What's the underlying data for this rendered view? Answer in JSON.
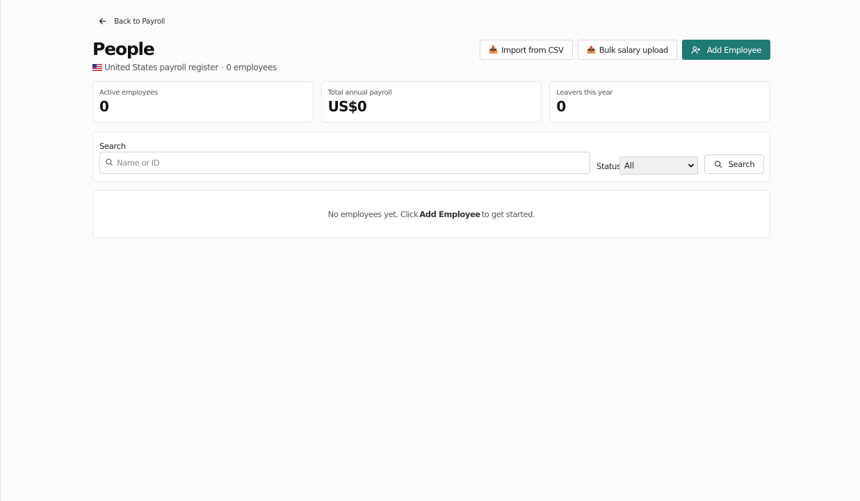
{
  "nav": {
    "back_label": "Back to Payroll"
  },
  "header": {
    "title": "People",
    "country_flag": "us-flag-icon",
    "subtitle_country": "United States payroll register",
    "subtitle_separator": "·",
    "subtitle_count": "0 employees"
  },
  "actions": {
    "import_icon": "📥",
    "import_label": "Import from CSV",
    "bulk_icon": "📤",
    "bulk_label": "Bulk salary upload",
    "add_label": "Add Employee"
  },
  "stats": [
    {
      "label": "Active employees",
      "value": "0"
    },
    {
      "label": "Total annual payroll",
      "value": "US$0"
    },
    {
      "label": "Leavers this year",
      "value": "0"
    }
  ],
  "filters": {
    "search_label": "Search",
    "search_placeholder": "Name or ID",
    "search_value": "",
    "status_label": "Status",
    "status_selected": "All",
    "search_button": "Search"
  },
  "empty_state": {
    "prefix": "No employees yet. Click",
    "highlight": "Add Employee",
    "suffix": "to get started."
  },
  "colors": {
    "primary": "#1f7a73",
    "background": "#fbfbfb",
    "card_border": "#e8e8e8"
  }
}
